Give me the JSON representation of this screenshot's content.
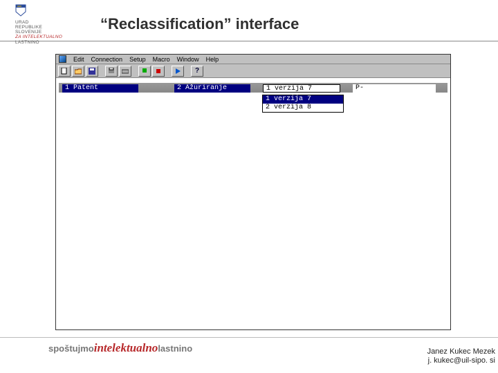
{
  "header": {
    "title": "“Reclassification” interface",
    "logo_lines": [
      "URAD",
      "REPUBLIKE",
      "SLOVENIJE",
      "ZA INTELEKTUALNO",
      "LASTNINO"
    ]
  },
  "app": {
    "menus": [
      "Edit",
      "Connection",
      "Setup",
      "Macro",
      "Window",
      "Help"
    ],
    "toolbar_icons": [
      "doc",
      "folder",
      "save",
      "sep",
      "print",
      "disk",
      "sep",
      "run",
      "stop",
      "sep",
      "play",
      "sep",
      "help"
    ],
    "row": {
      "c1": "1 Patent",
      "c2": "2 Ažuriranje",
      "c3": "1 verzija 7",
      "c4": "P-"
    },
    "dropdown": [
      "1 verzija 7",
      "2 verzija 8"
    ]
  },
  "footer": {
    "brand_a": "spoštujmo",
    "brand_b": "intelektualno",
    "brand_c": "lastnino",
    "author": "Janez Kukec Mezek",
    "email": "j. kukec@uil-sipo. si"
  }
}
